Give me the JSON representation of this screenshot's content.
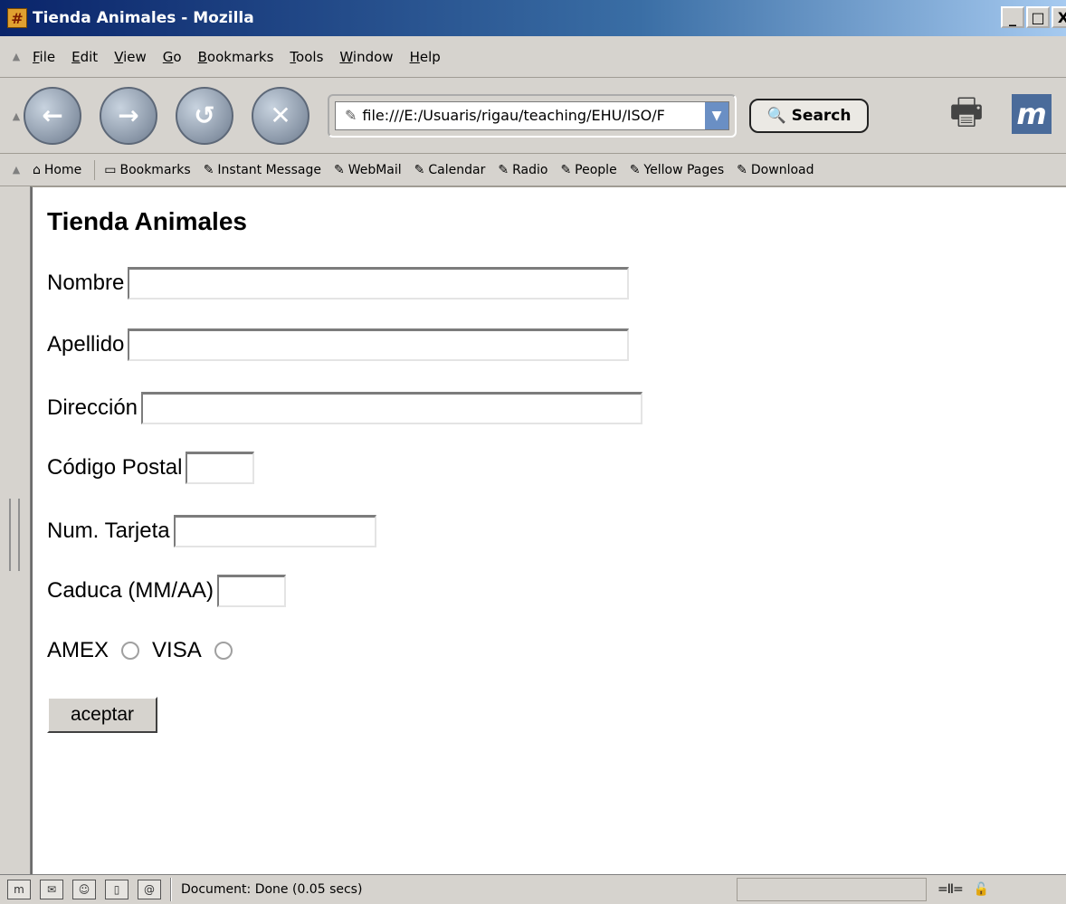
{
  "window": {
    "title": "Tienda Animales - Mozilla",
    "app_icon_glyph": "#",
    "minimize_glyph": "_",
    "maximize_glyph": "□",
    "close_glyph": "X"
  },
  "menu": {
    "items": [
      {
        "mnemonic": "F",
        "rest": "ile"
      },
      {
        "mnemonic": "E",
        "rest": "dit"
      },
      {
        "mnemonic": "V",
        "rest": "iew"
      },
      {
        "mnemonic": "G",
        "rest": "o"
      },
      {
        "mnemonic": "B",
        "rest": "ookmarks"
      },
      {
        "mnemonic": "T",
        "rest": "ools"
      },
      {
        "mnemonic": "W",
        "rest": "indow"
      },
      {
        "mnemonic": "H",
        "rest": "elp"
      }
    ]
  },
  "navigation": {
    "back_icon": "back-arrow-icon",
    "forward_icon": "forward-arrow-icon",
    "reload_icon": "reload-icon",
    "stop_icon": "stop-icon",
    "url": "file:///E:/Usuaris/rigau/teaching/EHU/ISO/F",
    "search_label": "Search"
  },
  "personal_toolbar": {
    "home": "Home",
    "bookmarks": "Bookmarks",
    "links": [
      "Instant Message",
      "WebMail",
      "Calendar",
      "Radio",
      "People",
      "Yellow Pages",
      "Download"
    ]
  },
  "page": {
    "title": "Tienda Animales",
    "fields": {
      "nombre": {
        "label": "Nombre",
        "value": ""
      },
      "apellido": {
        "label": "Apellido",
        "value": ""
      },
      "direccion": {
        "label": "Dirección",
        "value": ""
      },
      "codigo_postal": {
        "label": "Código Postal",
        "value": ""
      },
      "num_tarjeta": {
        "label": "Num. Tarjeta",
        "value": ""
      },
      "caduca": {
        "label": "Caduca (MM/AA)",
        "value": ""
      }
    },
    "card_type": {
      "options": [
        "AMEX",
        "VISA"
      ],
      "selected": ""
    },
    "submit_label": "aceptar"
  },
  "status": {
    "text": "Document: Done (0.05 secs)"
  },
  "colors": {
    "titlebar_start": "#0a246a",
    "chrome": "#d6d3ce",
    "content_bg": "#ffffff"
  }
}
